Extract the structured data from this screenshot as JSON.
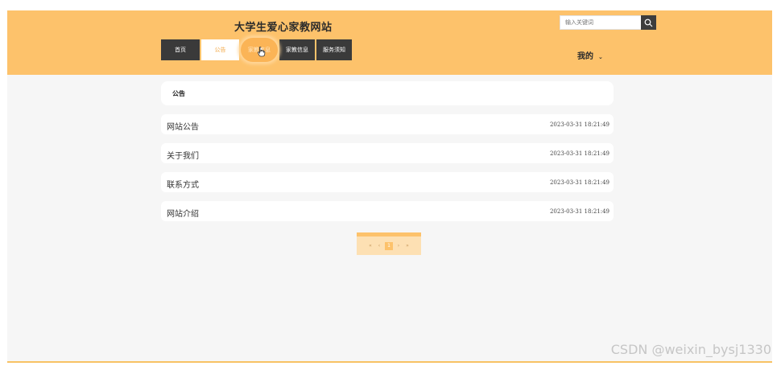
{
  "header": {
    "site_title": "大学生爱心家教网站",
    "search_placeholder": "输入关键词",
    "my_label": "我的",
    "my_caret": "⌄"
  },
  "nav": {
    "items": [
      {
        "label": "首页",
        "state": "normal"
      },
      {
        "label": "公告",
        "state": "active"
      },
      {
        "label": "家教信息",
        "state": "hover"
      },
      {
        "label": "家教信息",
        "state": "normal"
      },
      {
        "label": "服务须知",
        "state": "normal"
      }
    ]
  },
  "notice_panel": {
    "title": "公告",
    "rows": [
      {
        "title": "网站公告",
        "time": "2023-03-31 18:21:49"
      },
      {
        "title": "关于我们",
        "time": "2023-03-31 18:21:49"
      },
      {
        "title": "联系方式",
        "time": "2023-03-31 18:21:49"
      },
      {
        "title": "网站介绍",
        "time": "2023-03-31 18:21:49"
      }
    ]
  },
  "pagination": {
    "first": "«",
    "prev": "‹",
    "current": "1",
    "next": "›",
    "last": "»"
  },
  "watermark": "CSDN @weixin_bysj1330",
  "colors": {
    "header_bg": "#fdc26b",
    "nav_dark": "#3a3a3a",
    "accent": "#f3a948"
  }
}
